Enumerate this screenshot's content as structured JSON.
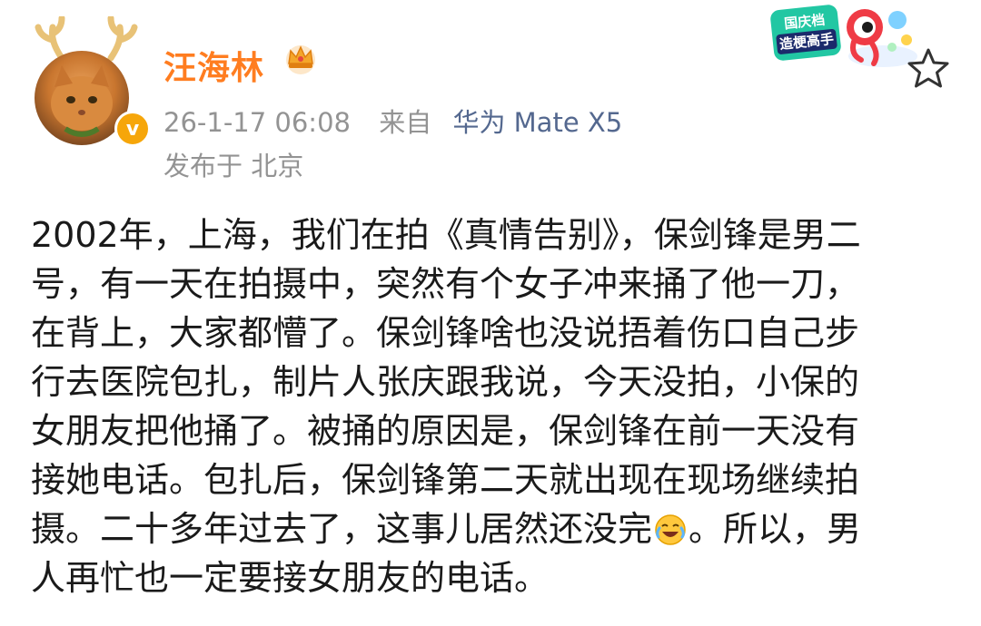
{
  "user": {
    "name": "汪海林",
    "verified_mark": "v",
    "member_icon": "crown-icon",
    "avatar_icon": "cat-avatar-with-antlers"
  },
  "post_meta": {
    "timestamp": "26-1-17 06:08",
    "source_prefix": "来自",
    "device": "华为 Mate X5",
    "location": "发布于 北京"
  },
  "promo": {
    "line1": "国庆档",
    "line2": "造梗高手"
  },
  "actions": {
    "favorite_icon": "star-outline-icon"
  },
  "post": {
    "lines": [
      "2002年，上海，我们在拍《真情告别》，保剑锋是男二",
      "号，有一天在拍摄中，突然有个女子冲来捅了他一刀，",
      "在背上，大家都懵了。保剑锋啥也没说捂着伤口自己步",
      "行去医院包扎，制片人张庆跟我说，今天没拍，小保的",
      "女朋友把他捅了。被捅的原因是，保剑锋在前一天没有",
      "接她电话。包扎后，保剑锋第二天就出现在现场继续拍"
    ],
    "line7_before": "摄。二十多年过去了，这事儿居然还没完",
    "line7_emoji": "laugh-cry-emoji-icon",
    "line7_after": "。所以，男",
    "line8": "人再忙也一定要接女朋友的电话。"
  },
  "colors": {
    "username": "#ff7d20",
    "meta_gray": "#939393",
    "device_link": "#54688f",
    "body_text": "#1a1a1a",
    "verified_badge": "#f6a60a"
  }
}
